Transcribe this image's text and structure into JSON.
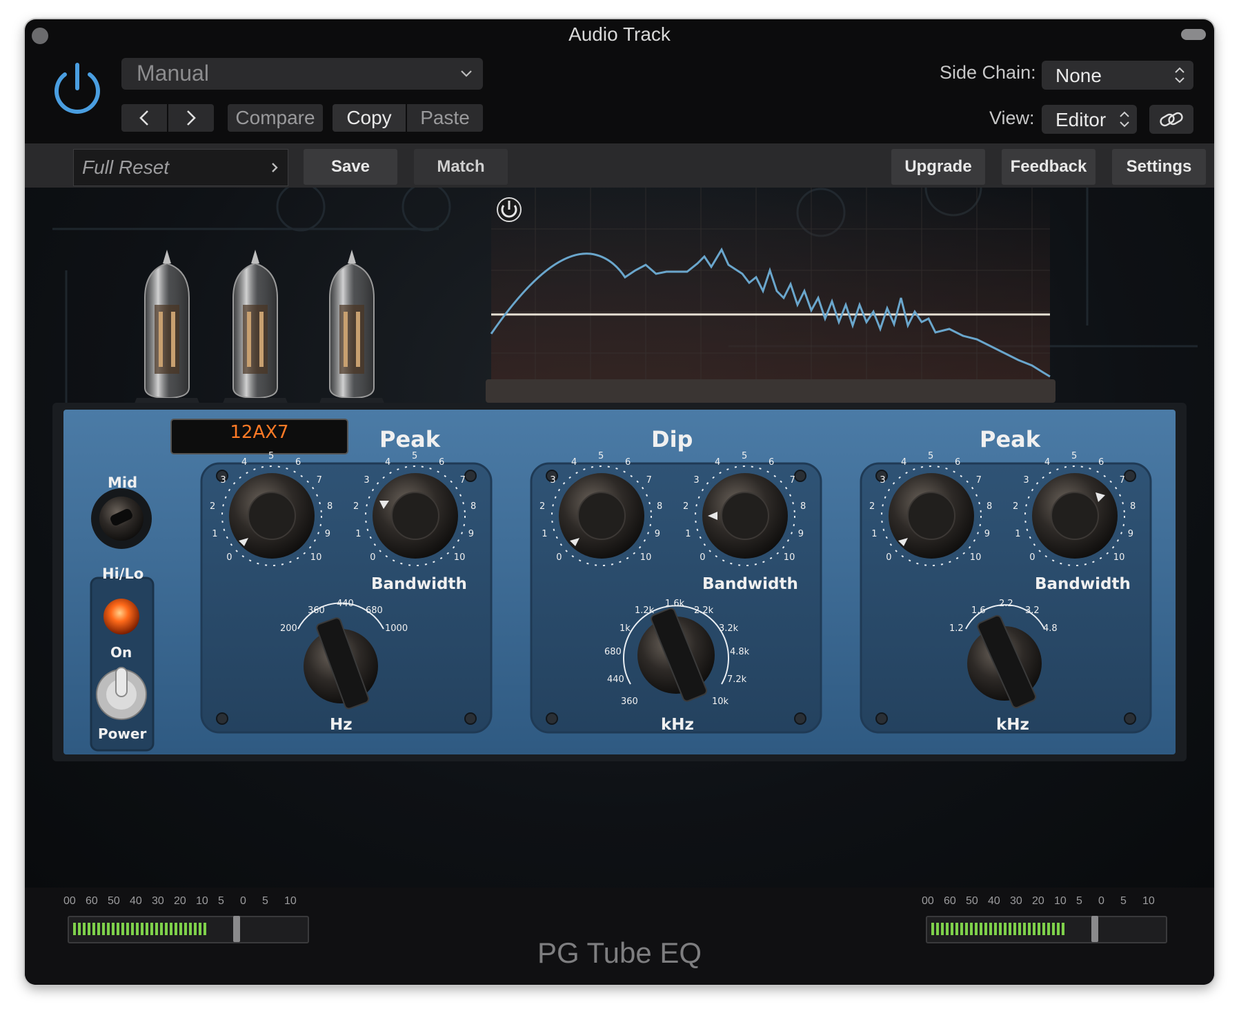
{
  "window": {
    "title": "Audio Track"
  },
  "header": {
    "preset": "Manual",
    "compare_label": "Compare",
    "copy_label": "Copy",
    "paste_label": "Paste",
    "side_chain_label": "Side Chain:",
    "side_chain_value": "None",
    "view_label": "View:",
    "view_value": "Editor"
  },
  "toolbar": {
    "preset_name": "Full Reset",
    "save_label": "Save",
    "match_label": "Match",
    "upgrade_label": "Upgrade",
    "feedback_label": "Feedback",
    "settings_label": "Settings"
  },
  "plugin": {
    "name": "PG Tube EQ",
    "tube_display": "12AX7",
    "mid_label": "Mid",
    "hilo_label": "Hi/Lo",
    "on_label": "On",
    "power_label": "Power",
    "knob_scale": [
      "0",
      "1",
      "2",
      "3",
      "4",
      "5",
      "6",
      "7",
      "8",
      "9",
      "10"
    ],
    "bands": [
      {
        "title": "Peak",
        "bandwidth_label": "Bandwidth",
        "unit_label": "Hz",
        "freq_labels": [
          "200",
          "360",
          "440",
          "680",
          "1000"
        ]
      },
      {
        "title": "Dip",
        "bandwidth_label": "Bandwidth",
        "unit_label": "kHz",
        "freq_labels": [
          "360",
          "440",
          "680",
          "1k",
          "1.2k",
          "1.6k",
          "2.2k",
          "3.2k",
          "4.8k",
          "7.2k",
          "10k"
        ]
      },
      {
        "title": "Peak",
        "bandwidth_label": "Bandwidth",
        "unit_label": "kHz",
        "freq_labels": [
          "1.2",
          "1.6",
          "2.2",
          "3.2",
          "4.8"
        ]
      }
    ]
  },
  "meters": {
    "scale": [
      "00",
      "60",
      "50",
      "40",
      "30",
      "20",
      "10",
      "5",
      "0",
      "5",
      "10"
    ],
    "input_level": 0.72,
    "output_level": 0.72
  },
  "colors": {
    "accent": "#4a9ee0",
    "panel_blue": "#3f6f9a",
    "tube_orange": "#ff6a1a",
    "meter_green": "#7fd14b"
  }
}
